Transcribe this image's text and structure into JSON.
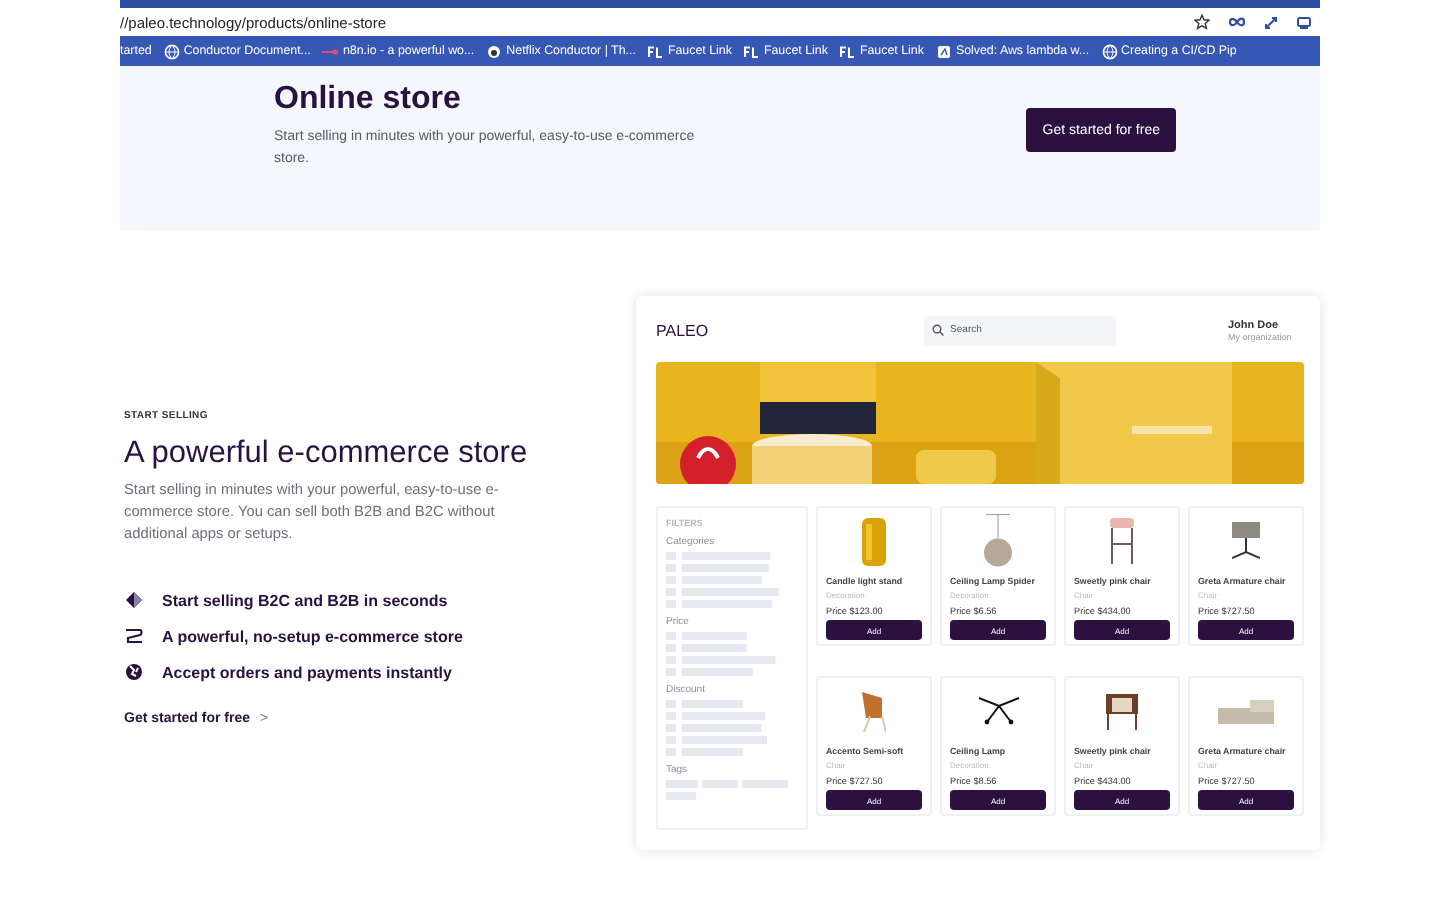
{
  "browser": {
    "url": "//paleo.technology/products/online-store",
    "bookmarks": [
      {
        "label": "tarted"
      },
      {
        "label": "Conductor Document..."
      },
      {
        "label": "n8n.io - a powerful wo..."
      },
      {
        "label": "Netflix Conductor | Th..."
      },
      {
        "label": "Faucet Link"
      },
      {
        "label": "Faucet Link"
      },
      {
        "label": "Faucet Link"
      },
      {
        "label": "Solved: Aws lambda w..."
      },
      {
        "label": "Creating a CI/CD Pip"
      }
    ]
  },
  "hero": {
    "title": "Online store",
    "subtitle": "Start selling in minutes with your powerful, easy-to-use e-commerce store.",
    "button": "Get started for free"
  },
  "section": {
    "eyebrow": "START SELLING",
    "title": "A powerful e-commerce store",
    "body": "Start selling in minutes with your powerful, easy-to-use e-commerce store. You can sell both B2B and B2C without additional apps or setups.",
    "features": [
      {
        "kind": "cube",
        "text": "Start selling B2C and B2B in seconds"
      },
      {
        "kind": "stripes",
        "text": "A powerful, no-setup e-commerce store"
      },
      {
        "kind": "globe",
        "text": "Accept orders and payments instantly"
      }
    ],
    "link": "Get started for free",
    "link_arrow": ">"
  },
  "mockup": {
    "brand": "PALEO",
    "search_placeholder": "Search",
    "user": {
      "name": "John Doe",
      "org": "My organization"
    },
    "filters": {
      "title": "FILTERS",
      "groups": [
        "Categories",
        "Price",
        "Discount",
        "Tags"
      ]
    },
    "products": [
      {
        "name": "Candle light stand",
        "category": "Decoration",
        "price": "Price $123.00",
        "button": "Add",
        "kind": "vase"
      },
      {
        "name": "Ceiling Lamp Spider",
        "category": "Decoration",
        "price": "Price $6.56",
        "button": "Add",
        "kind": "lamp"
      },
      {
        "name": "Sweetly pink chair",
        "category": "Chair",
        "price": "Price $434.00",
        "button": "Add",
        "kind": "stool"
      },
      {
        "name": "Greta Armature chair",
        "category": "Chair",
        "price": "Price $727.50",
        "button": "Add",
        "kind": "office"
      },
      {
        "name": "Accento Semi-soft",
        "category": "Chair",
        "price": "Price $727.50",
        "button": "Add",
        "kind": "lounge"
      },
      {
        "name": "Ceiling Lamp",
        "category": "Decoration",
        "price": "Price $8.56",
        "button": "Add",
        "kind": "spider"
      },
      {
        "name": "Sweetly pink chair",
        "category": "Chair",
        "price": "Price $434.00",
        "button": "Add",
        "kind": "armchair"
      },
      {
        "name": "Greta Armature chair",
        "category": "Chair",
        "price": "Price $727.50",
        "button": "Add",
        "kind": "sofa"
      }
    ]
  }
}
